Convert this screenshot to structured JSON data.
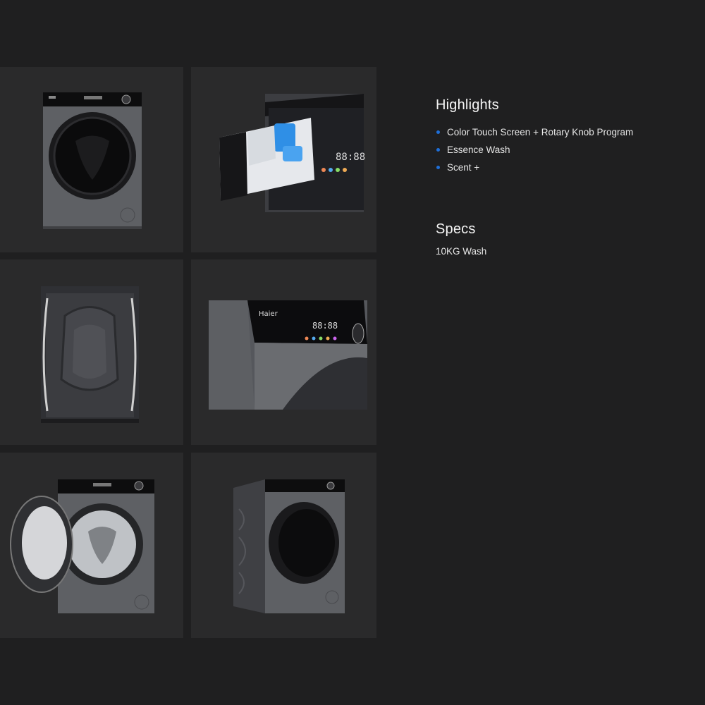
{
  "gallery": {
    "images": [
      {
        "icon": "washer-front-view"
      },
      {
        "icon": "detergent-drawer-closeup"
      },
      {
        "icon": "washer-back-view"
      },
      {
        "icon": "control-panel-closeup"
      },
      {
        "icon": "washer-door-open"
      },
      {
        "icon": "washer-side-view"
      }
    ]
  },
  "highlights": {
    "title": "Highlights",
    "items": [
      "Color Touch Screen + Rotary Knob Program",
      "Essence Wash",
      "Scent +"
    ],
    "bullet_color": "#1e6fd9"
  },
  "specs": {
    "title": "Specs",
    "text": "10KG Wash"
  }
}
